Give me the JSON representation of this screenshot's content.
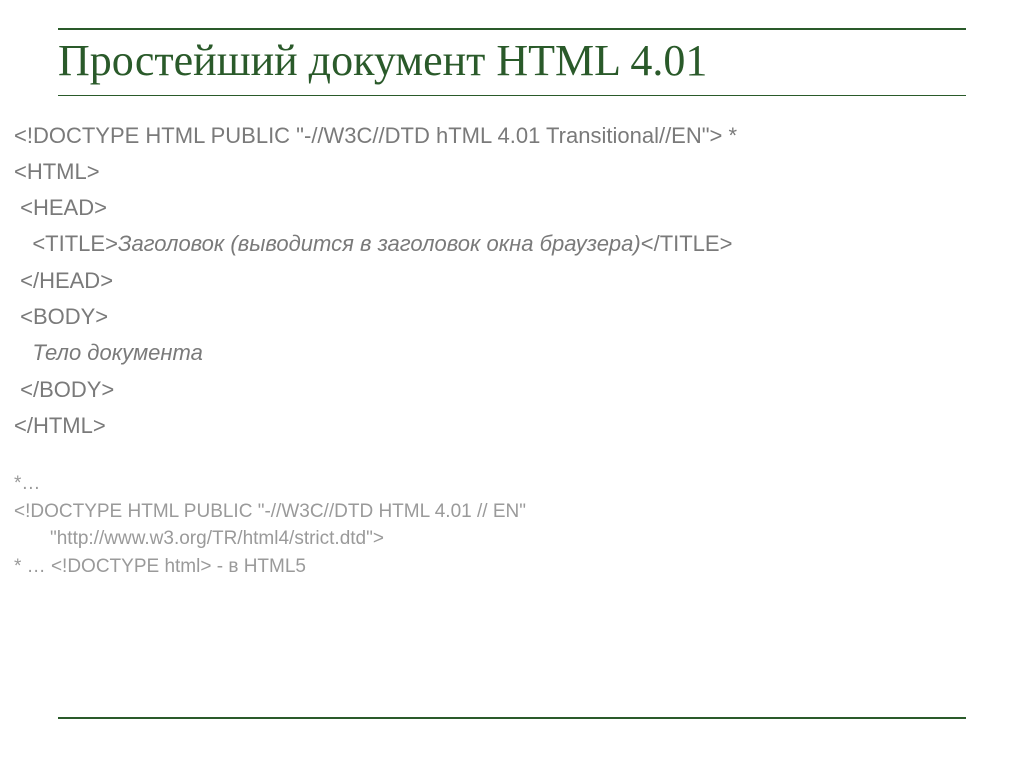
{
  "slide": {
    "title": "Простейший документ HTML 4.01",
    "code": {
      "line1": "<!DOCTYPE HTML PUBLIC \"-//W3C//DTD hTML 4.01 Transitional//EN\"> *",
      "line2": "<HTML>",
      "line3": " <HEAD>",
      "line4_open": "   <TITLE>",
      "line4_text": "Заголовок (выводится в заголовок окна браузера)",
      "line4_close": "</TITLE>",
      "line5": " </HEAD>",
      "line6": " <BODY>",
      "line7": "   Тело документа",
      "line8": " </BODY>",
      "line9": "</HTML>"
    },
    "footnote": {
      "f1": "*…",
      "f2": "<!DOCTYPE  HTML PUBLIC \"-//W3C//DTD HTML 4.01 // EN\"",
      "f3": "\"http://www.w3.org/TR/html4/strict.dtd\">",
      "f4": "* … <!DOCTYPE html> - в HTML5"
    }
  }
}
